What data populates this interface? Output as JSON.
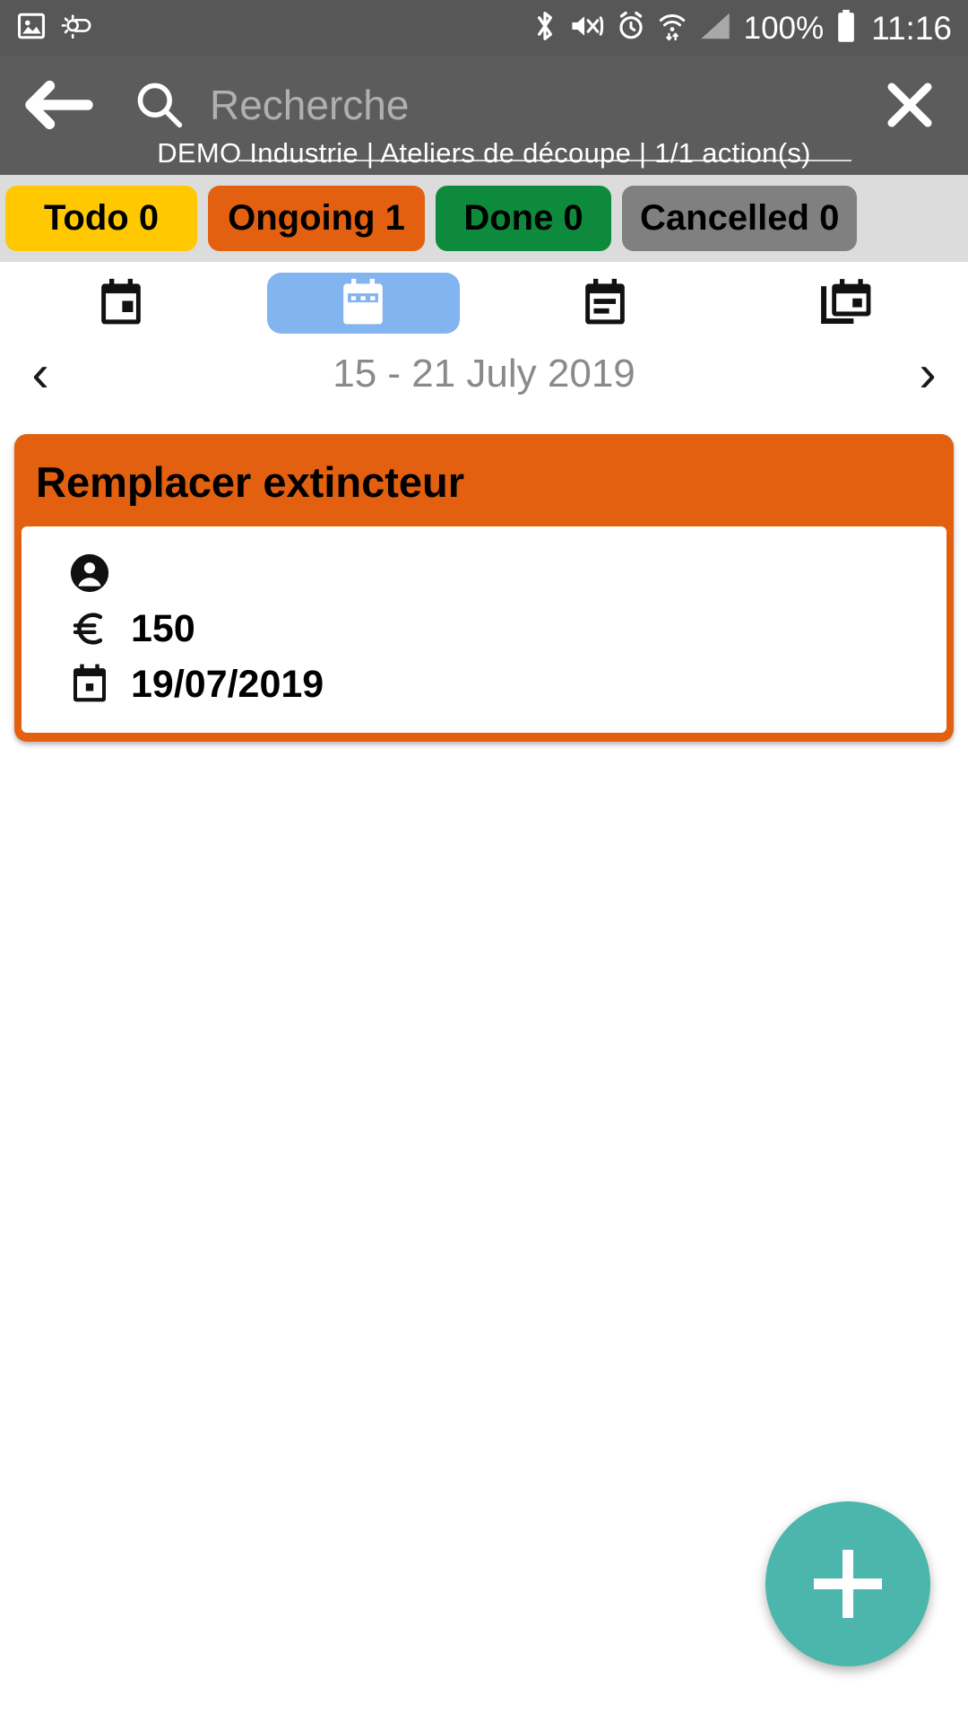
{
  "status_bar": {
    "icons": [
      "image-icon",
      "weather-icon",
      "bluetooth-icon",
      "mute-vibrate-icon",
      "alarm-icon",
      "wifi-icon",
      "signal-icon",
      "battery-icon"
    ],
    "battery_percent": "100%",
    "clock": "11:16"
  },
  "app_bar": {
    "back_label": "back-arrow",
    "search_placeholder": "Recherche",
    "search_value": "",
    "close_label": "close",
    "subtitle": "DEMO Industrie | Ateliers de découpe | 1/1 action(s)"
  },
  "tabs": [
    {
      "label": "Todo 0",
      "color": "#FFC800"
    },
    {
      "label": "Ongoing 1",
      "color": "#E2600F"
    },
    {
      "label": "Done 0",
      "color": "#0E8A3C"
    },
    {
      "label": "Cancelled 0",
      "color": "#808080"
    }
  ],
  "view_switcher": {
    "selected_index": 1,
    "selected_color": "#82B4F0",
    "items": [
      {
        "name": "day-view",
        "icon": "calendar-day-icon"
      },
      {
        "name": "week-view",
        "icon": "calendar-week-icon"
      },
      {
        "name": "month-view",
        "icon": "calendar-agenda-icon"
      },
      {
        "name": "list-view",
        "icon": "calendar-stack-icon"
      }
    ]
  },
  "date_nav": {
    "prev": "‹",
    "next": "›",
    "range_label": "15 - 21 July 2019"
  },
  "task_card": {
    "title": "Remplacer extincteur",
    "accent_color": "#E2600F",
    "details": [
      {
        "icon": "person-icon",
        "value": ""
      },
      {
        "icon": "euro-icon",
        "value": "150"
      },
      {
        "icon": "calendar-icon",
        "value": "19/07/2019"
      }
    ]
  },
  "fab": {
    "label": "+",
    "color": "#4DB6AC"
  }
}
